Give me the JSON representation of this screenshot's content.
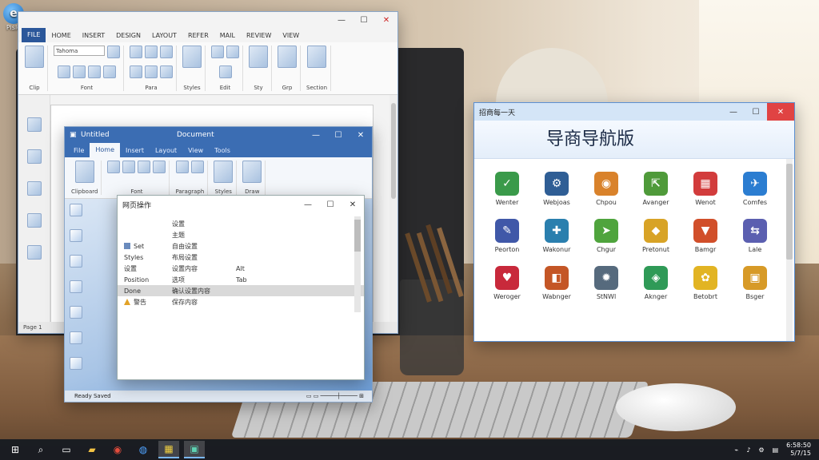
{
  "desktop": {
    "icon_label": "Pisle"
  },
  "word": {
    "tabs": [
      "FILE",
      "HOME",
      "INSERT",
      "DESIGN",
      "LAYOUT",
      "REFER",
      "MAIL",
      "REVIEW",
      "VIEW"
    ],
    "font_box": "Tahoma",
    "groups": [
      "Font",
      "Clip",
      "Para",
      "Styles",
      "Edit",
      "Sty",
      "Grp",
      "Section"
    ],
    "status": "Page 1"
  },
  "word2": {
    "title": "Untitled",
    "center_title": "Document",
    "tabs": [
      "File",
      "Home",
      "Insert",
      "Layout",
      "View",
      "Tools"
    ],
    "status_left": "Ready  Saved",
    "groups": [
      "Clipboard",
      "Font",
      "Paragraph",
      "Styles",
      "Draw"
    ]
  },
  "dialog": {
    "title": "网页操作",
    "rows": [
      {
        "c1": "",
        "c2": "设置",
        "c3": ""
      },
      {
        "c1": "",
        "c2": "主题",
        "c3": ""
      },
      {
        "c1": "Set",
        "c2": "自由设置",
        "c3": ""
      },
      {
        "c1": "Styles",
        "c2": "布局设置",
        "c3": ""
      },
      {
        "c1": "设置",
        "c2": "设置内容",
        "c3": "Alt"
      },
      {
        "c1": "Position",
        "c2": "选项",
        "c3": "Tab"
      },
      {
        "c1": "Done",
        "c2": "确认设置内容",
        "c3": ""
      },
      {
        "c1": "警告",
        "c2": "保存内容",
        "c3": ""
      }
    ]
  },
  "nav": {
    "title": "招商每一天",
    "header": "导商导航版",
    "apps": [
      {
        "label": "Wenter",
        "color": "#3a9a4a",
        "glyph": "✓"
      },
      {
        "label": "Webjoas",
        "color": "#2f5e95",
        "glyph": "⚙"
      },
      {
        "label": "Chpou",
        "color": "#d9822b",
        "glyph": "◉"
      },
      {
        "label": "Avanger",
        "color": "#4f9a3a",
        "glyph": "⇱"
      },
      {
        "label": "Wenot",
        "color": "#d23c3c",
        "glyph": "▦"
      },
      {
        "label": "Comfes",
        "color": "#2b7dd1",
        "glyph": "✈"
      },
      {
        "label": "Peorton",
        "color": "#4058a8",
        "glyph": "✎"
      },
      {
        "label": "Wakonur",
        "color": "#2a7fae",
        "glyph": "✚"
      },
      {
        "label": "Chgur",
        "color": "#4fa43d",
        "glyph": "➤"
      },
      {
        "label": "Pretonut",
        "color": "#d8a326",
        "glyph": "◆"
      },
      {
        "label": "Bamgr",
        "color": "#d14f2a",
        "glyph": "▼"
      },
      {
        "label": "Lale",
        "color": "#5b5fb0",
        "glyph": "⇆"
      },
      {
        "label": "Weroger",
        "color": "#c8293b",
        "glyph": "♥"
      },
      {
        "label": "Wabnger",
        "color": "#c45626",
        "glyph": "◧"
      },
      {
        "label": "StNWl",
        "color": "#566a7d",
        "glyph": "✹"
      },
      {
        "label": "Aknger",
        "color": "#2f9a57",
        "glyph": "◈"
      },
      {
        "label": "Betobrt",
        "color": "#e2b423",
        "glyph": "✿"
      },
      {
        "label": "Bsger",
        "color": "#d79a27",
        "glyph": "▣"
      }
    ]
  },
  "taskbar": {
    "items": [
      "start-icon",
      "search-icon",
      "folder-icon",
      "chrome-icon",
      "ie-icon",
      "app-grid-icon",
      "app-icon"
    ],
    "clock_time": "6:58:50",
    "clock_date": "5/7/15"
  }
}
